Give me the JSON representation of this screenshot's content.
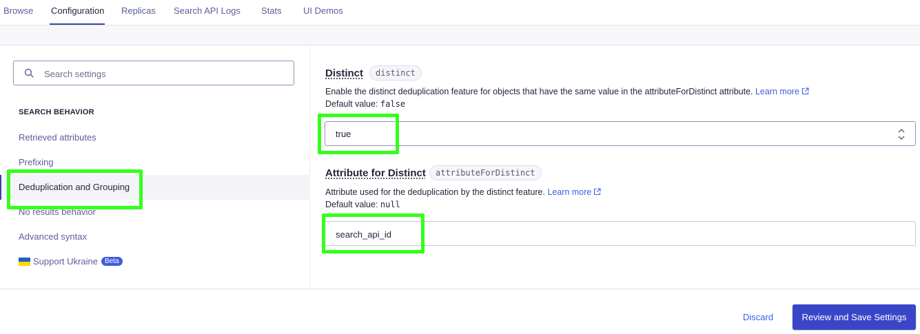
{
  "tabs": [
    {
      "label": "Browse",
      "active": false
    },
    {
      "label": "Configuration",
      "active": true
    },
    {
      "label": "Replicas",
      "active": false
    },
    {
      "label": "Search API Logs",
      "active": false
    },
    {
      "label": "Stats",
      "active": false
    },
    {
      "label": "UI Demos",
      "active": false
    }
  ],
  "sidebar": {
    "search_placeholder": "Search settings",
    "section_title": "SEARCH BEHAVIOR",
    "items": [
      {
        "label": "Retrieved attributes"
      },
      {
        "label": "Prefixing"
      },
      {
        "label": "Deduplication and Grouping",
        "active": true
      },
      {
        "label": "No results behavior"
      },
      {
        "label": "Advanced syntax"
      },
      {
        "label": "Support Ukraine",
        "badge": "Beta"
      }
    ]
  },
  "settings": {
    "distinct": {
      "title": "Distinct",
      "code": "distinct",
      "description": "Enable the distinct deduplication feature for objects that have the same value in the attributeForDistinct attribute.",
      "learn_more": "Learn more",
      "default_label": "Default value:",
      "default_value": "false",
      "value": "true"
    },
    "attribute_for_distinct": {
      "title": "Attribute for Distinct",
      "code": "attributeForDistinct",
      "description": "Attribute used for the deduplication by the distinct feature.",
      "learn_more": "Learn more",
      "default_label": "Default value:",
      "default_value": "null",
      "value": "search_api_id"
    }
  },
  "footer": {
    "discard_label": "Discard",
    "save_label": "Review and Save Settings"
  },
  "colors": {
    "accent": "#3a46c8",
    "link": "#3d5ce0",
    "highlight": "#33ff1a"
  }
}
